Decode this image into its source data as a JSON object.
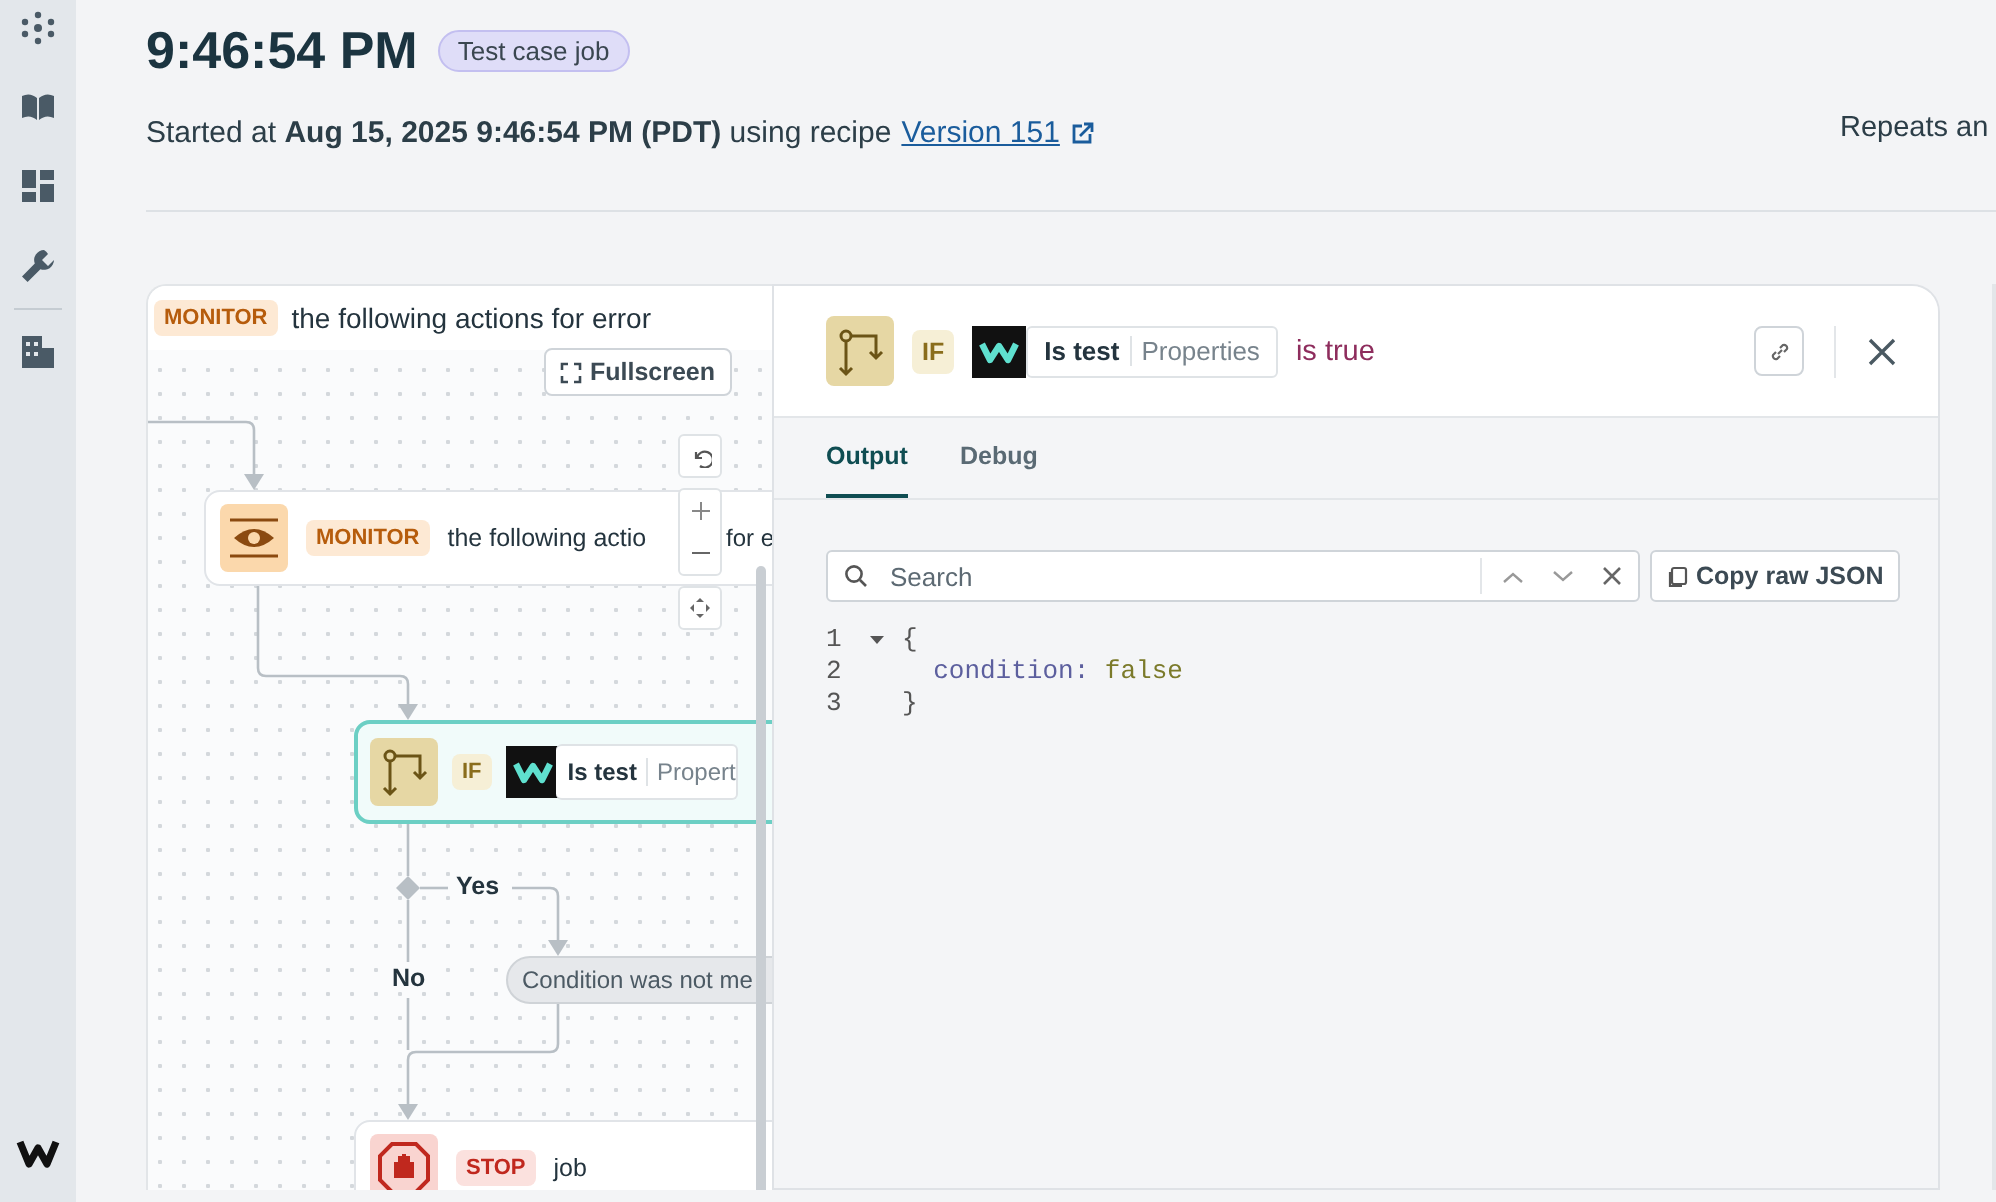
{
  "header": {
    "title": "9:46:54 PM",
    "badge": "Test case job",
    "subtitle": "Started at **Aug 15, 2025 9:46:54 PM (PDT)** using recipe",
    "link": "Version 151",
    "side_text": "Repeats an"
  },
  "canvas": {
    "header_badge": "MONITOR",
    "header_text": "the following actions for error",
    "fullscreen": "Fullscreen",
    "nodes": [
      {
        "kind": "monitor",
        "badge": "MONITOR",
        "text": "the following actio",
        "text_after": "for e",
        "selected": false
      },
      {
        "kind": "if",
        "badge": "IF",
        "label": "Is test",
        "field": "Propert",
        "selected": true
      },
      {
        "kind": "stop",
        "badge": "STOP",
        "text": "job",
        "selected": false
      }
    ],
    "branch": {
      "yes": "Yes",
      "no": "No",
      "skipped": "Condition was not me"
    }
  },
  "panel": {
    "badge": "IF",
    "label": "Is test",
    "field": "Properties",
    "condition": "is true",
    "tabs": [
      {
        "label": "Output",
        "selected": true
      },
      {
        "label": "Debug",
        "selected": false
      }
    ],
    "search": {
      "placeholder": "Search"
    },
    "copy_button": "Copy raw JSON",
    "code": [
      {
        "number": "1",
        "text": "{",
        "expanded": true
      },
      {
        "number": "2",
        "key": "condition:",
        "value": "false"
      },
      {
        "number": "3",
        "text": "}"
      }
    ]
  }
}
